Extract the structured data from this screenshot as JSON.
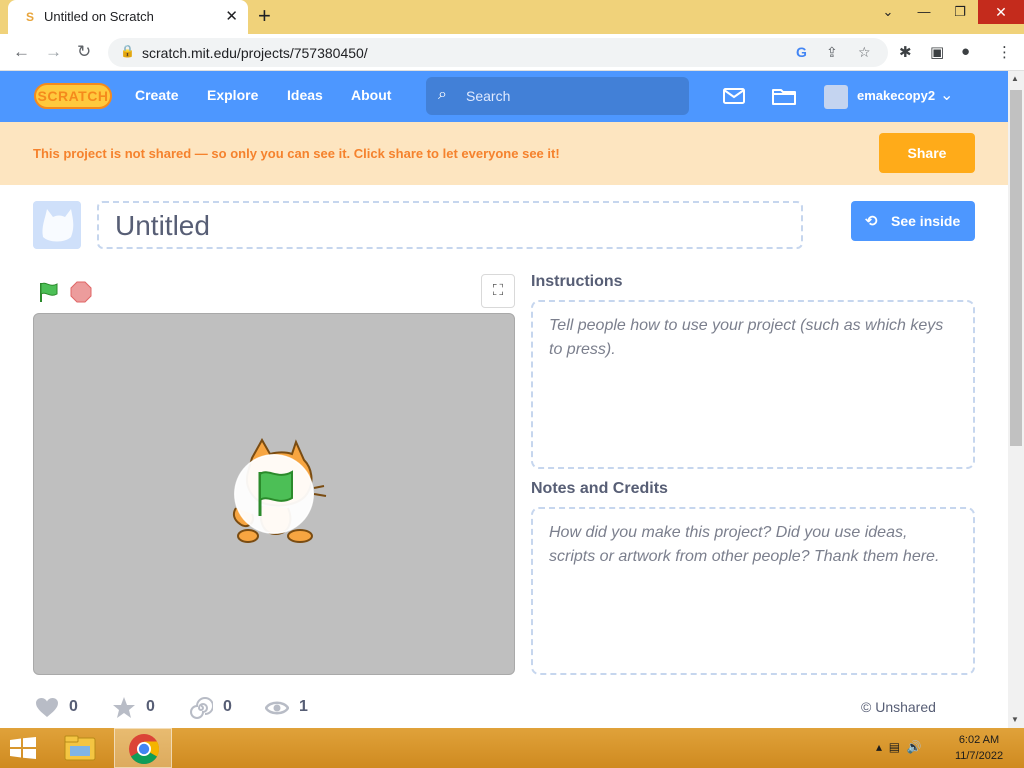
{
  "browser": {
    "tab_title": "Untitled on Scratch",
    "url": "scratch.mit.edu/projects/757380450/"
  },
  "nav": {
    "logo": "SCRATCH",
    "links": [
      "Create",
      "Explore",
      "Ideas",
      "About"
    ],
    "search_placeholder": "Search",
    "username": "emakecopy2"
  },
  "banner": {
    "message": "This project is not shared — so only you can see it. Click share to let everyone see it!",
    "share_label": "Share"
  },
  "project": {
    "title": "Untitled",
    "see_inside_label": "See inside"
  },
  "instructions": {
    "heading": "Instructions",
    "placeholder": "Tell people how to use your project (such as which keys to press)."
  },
  "notes": {
    "heading": "Notes and Credits",
    "placeholder": "How did you make this project? Did you use ideas, scripts or artwork from other people? Thank them here."
  },
  "stats": {
    "loves": "0",
    "favorites": "0",
    "remixes": "0",
    "views": "1",
    "share_status": "© Unshared"
  },
  "taskbar": {
    "time": "6:02 AM",
    "date": "11/7/2022"
  },
  "colors": {
    "scratch_blue": "#4d97ff",
    "banner_bg": "#fde5c0",
    "banner_text": "#f5822d",
    "share_orange": "#ffab19"
  }
}
